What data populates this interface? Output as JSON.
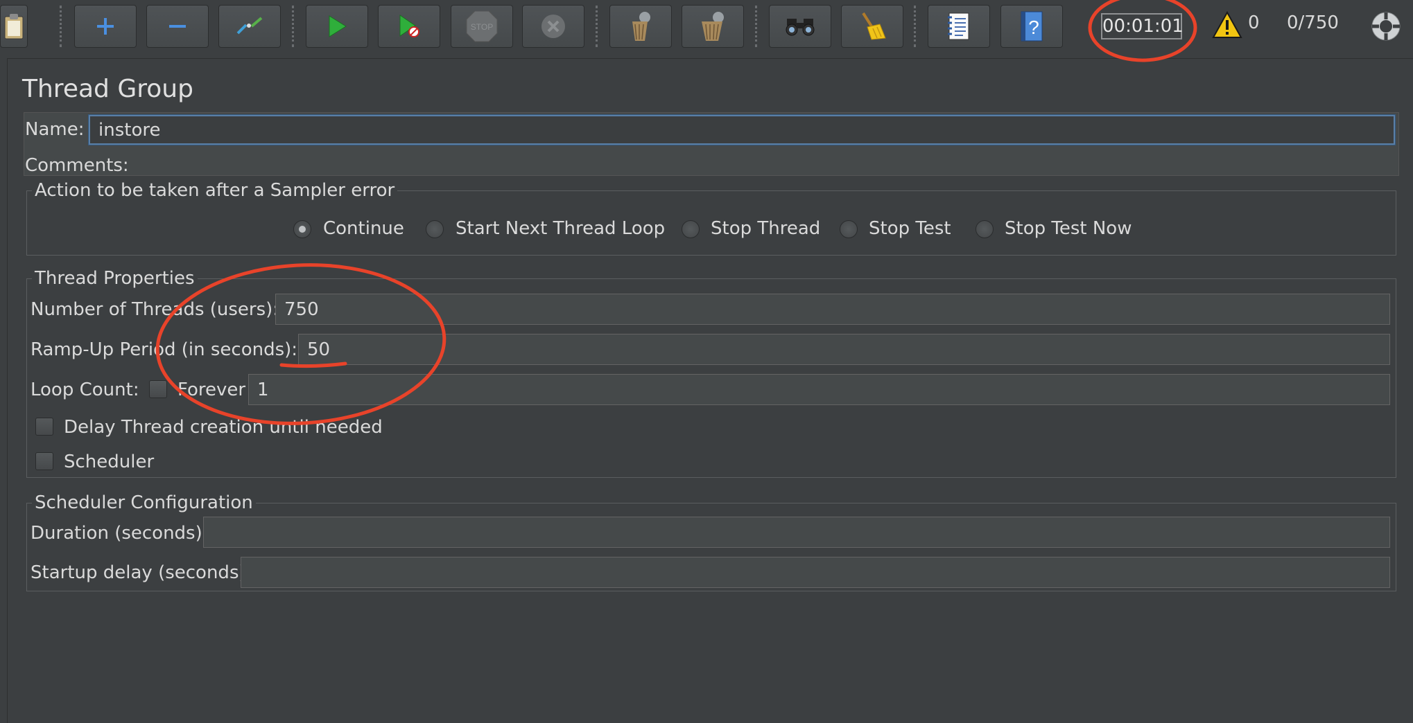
{
  "toolbar": {
    "buttons": [
      {
        "name": "clipboard-icon"
      },
      {
        "name": "add-icon"
      },
      {
        "name": "remove-icon"
      },
      {
        "name": "toggle-icon"
      },
      {
        "name": "start-icon"
      },
      {
        "name": "start-no-pauses-icon"
      },
      {
        "name": "stop-icon"
      },
      {
        "name": "shutdown-icon"
      },
      {
        "name": "clear-icon"
      },
      {
        "name": "clear-all-icon"
      },
      {
        "name": "search-icon"
      },
      {
        "name": "reset-search-icon"
      },
      {
        "name": "function-helper-icon"
      },
      {
        "name": "help-icon"
      }
    ],
    "stop_label": "STOP",
    "timer": "00:01:01",
    "warnings": "0",
    "active_threads": "0/750"
  },
  "thread_group": {
    "title": "Thread Group",
    "name_label": "Name:",
    "name_value": "instore",
    "comments_label": "Comments:"
  },
  "sampler_error": {
    "legend": "Action to be taken after a Sampler error",
    "options": [
      "Continue",
      "Start Next Thread Loop",
      "Stop Thread",
      "Stop Test",
      "Stop Test Now"
    ],
    "selected": "Continue"
  },
  "thread_properties": {
    "legend": "Thread Properties",
    "threads_label": "Number of Threads (users):",
    "threads_value": "750",
    "rampup_label": "Ramp-Up Period (in seconds):",
    "rampup_value": "50",
    "loop_label": "Loop Count:",
    "forever_label": "Forever",
    "loop_value": "1",
    "delay_label": "Delay Thread creation until needed",
    "scheduler_label": "Scheduler"
  },
  "scheduler_config": {
    "legend": "Scheduler Configuration",
    "duration_label": "Duration (seconds)",
    "duration_value": "",
    "startup_label": "Startup delay (seconds)",
    "startup_value": ""
  },
  "colors": {
    "background": "#3c3f41",
    "annotation": "#e8432a",
    "focus_border": "#5a7fa7"
  }
}
